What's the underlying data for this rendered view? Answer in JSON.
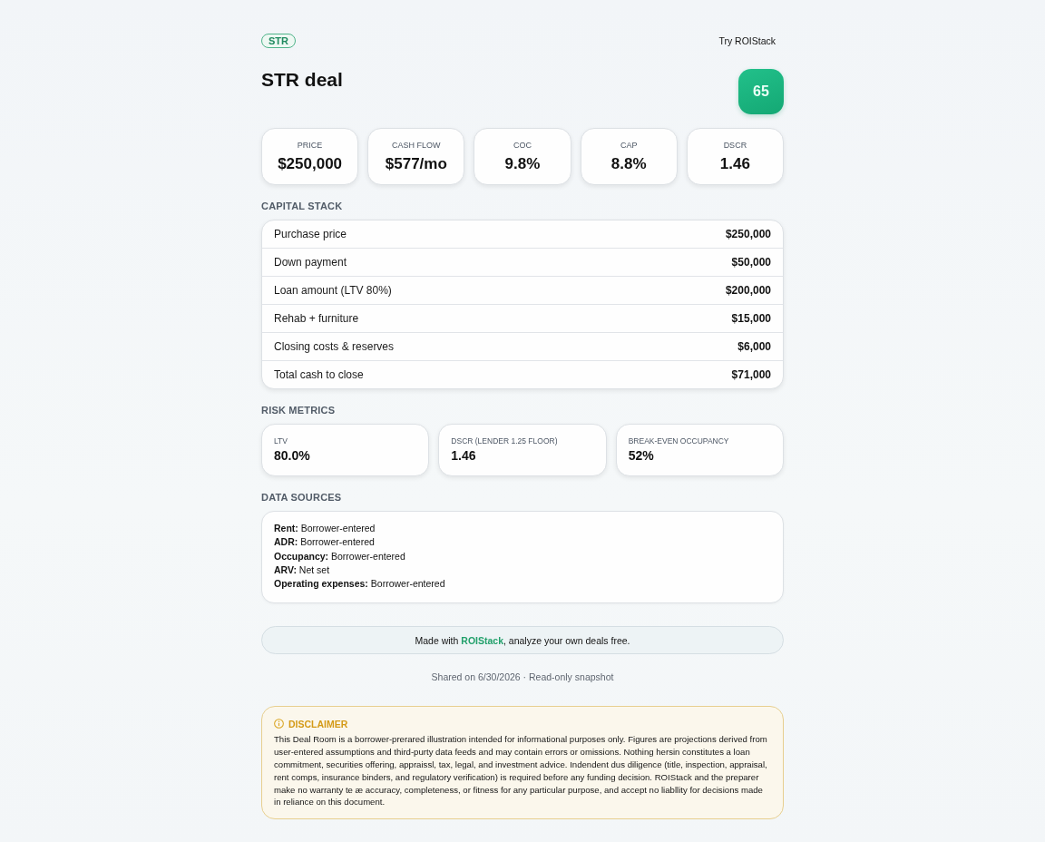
{
  "header": {
    "badge": "STR",
    "link": "Try ROIStack"
  },
  "title": "STR deal",
  "score": "65",
  "metrics": [
    {
      "label": "PRICE",
      "value": "$250,000"
    },
    {
      "label": "CASH FLOW",
      "value": "$577/mo"
    },
    {
      "label": "COC",
      "value": "9.8%"
    },
    {
      "label": "CAP",
      "value": "8.8%"
    },
    {
      "label": "DSCR",
      "value": "1.46"
    }
  ],
  "capital_stack": {
    "heading": "CAPITAL STACK",
    "rows": [
      {
        "label": "Purchase price",
        "value": "$250,000"
      },
      {
        "label": "Down payment",
        "value": "$50,000"
      },
      {
        "label": "Loan amount (LTV 80%)",
        "value": "$200,000"
      },
      {
        "label": "Rehab + furniture",
        "value": "$15,000"
      },
      {
        "label": "Closing costs & reserves",
        "value": "$6,000"
      },
      {
        "label": "Total cash to close",
        "value": "$71,000"
      }
    ]
  },
  "risk_metrics": {
    "heading": "RISK METRICS",
    "items": [
      {
        "label": "LTV",
        "value": "80.0%"
      },
      {
        "label": "DSCR (LENDER 1.25 FLOOR)",
        "value": "1.46"
      },
      {
        "label": "BREAK-EVEN OCCUPANCY",
        "value": "52%"
      }
    ]
  },
  "data_sources": {
    "heading": "DATA SOURCES",
    "lines": [
      "**Rent:** Borrower-entered",
      "**ADR:** Borrower-entered",
      "**Occupancy:** Borrower-entered",
      "**ARV:** Net set",
      "**Operating expenses:** Borrower-entered"
    ]
  },
  "promo": {
    "before": "Made with ",
    "link": "ROIStack",
    "after": ", analyze your own deals free."
  },
  "footer": "Shared on 6/30/2026 · Read-only snapshot",
  "disclaimer": {
    "heading": "DISCLAIMER",
    "body": "This Deal Room is a borrower-prerared illustration intended for informational purposes only. Figures are projections derived from user-entered assumptions and third-purty data feeds and may contain errors or omissions. Nothing hersin constitutes a loan commitment, securities offering, appraissl, tax, legal, and investment advice. Indendent dus diligence (title, inspection, appraisal, rent comps, insurance binders, and regulatory verification) is required before any funding decision. ROIStack and the preparer make no warranty te æ accuracy, completeness, or fitness for any particular purpose, and accept no liabllity for decisions made in reliance on this document."
  }
}
